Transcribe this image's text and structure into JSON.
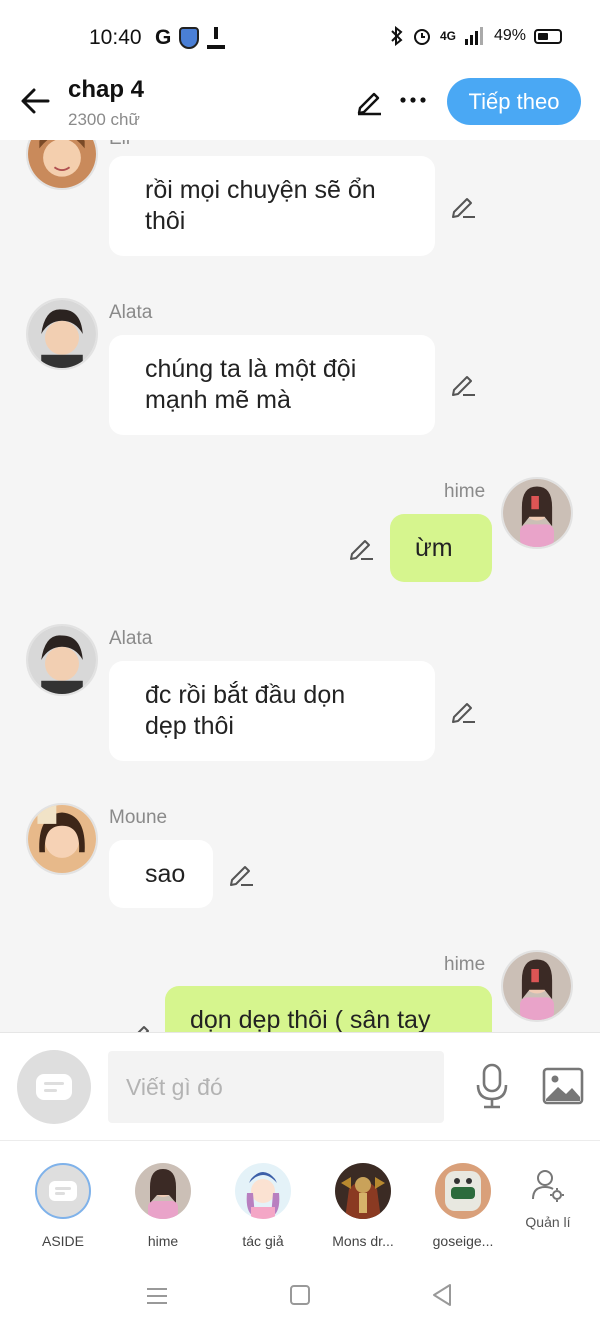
{
  "status_bar": {
    "time": "10:40",
    "network": "4G",
    "battery": "49%"
  },
  "header": {
    "title": "chap 4",
    "subtitle": "2300 chữ",
    "next_label": "Tiếp theo",
    "accent_color": "#4aa8f4"
  },
  "chat": {
    "partial_name_top": "Eli",
    "messages": [
      {
        "author": "",
        "side": "left",
        "text_line1": "rồi mọi chuyện sẽ ổn",
        "text_line2": "thôi"
      },
      {
        "author": "Alata",
        "side": "left",
        "text_line1": "chúng ta là một đội",
        "text_line2": "mạnh mẽ mà"
      },
      {
        "author": "hime",
        "side": "right",
        "text_line1": "ừm"
      },
      {
        "author": "Alata",
        "side": "left",
        "text_line1": "đc rồi bắt đầu dọn",
        "text_line2": "dẹp thôi"
      },
      {
        "author": "Moune",
        "side": "left",
        "text_line1": "sao"
      },
      {
        "author": "hime",
        "side": "right",
        "text_line1": "dọn dẹp thôi ( sân tay"
      }
    ],
    "my_bubble_color": "#d6f58e"
  },
  "composer": {
    "placeholder": "Viết gì đó"
  },
  "characters": [
    {
      "label": "ASIDE"
    },
    {
      "label": "hime"
    },
    {
      "label": "tác giả"
    },
    {
      "label": "Mons dr..."
    },
    {
      "label": "goseige..."
    }
  ],
  "manage_label": "Quản lí"
}
